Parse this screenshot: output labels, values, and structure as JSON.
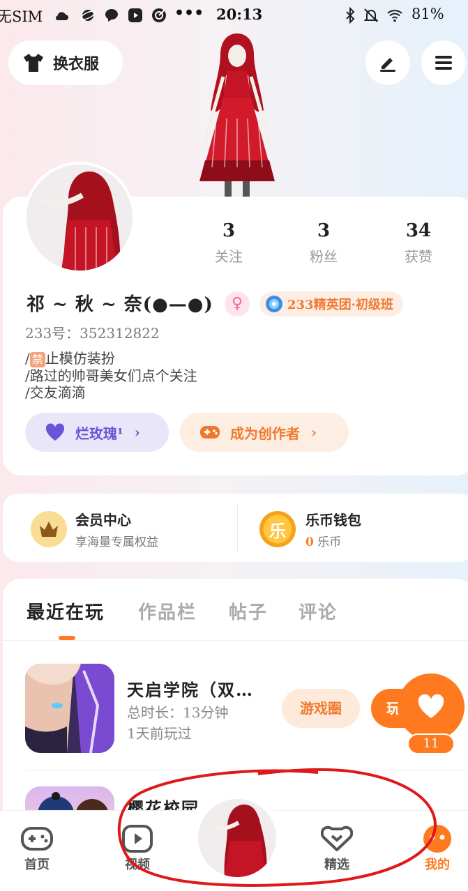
{
  "status_bar": {
    "sim": "无SIM",
    "time": "20:13",
    "battery": "81%"
  },
  "header": {
    "wardrobe_label": "换衣服"
  },
  "profile": {
    "username": "祁 ~ 秋 ~ 奈(●—●)",
    "uid_label": "233号：352312822",
    "gender_symbol": "♀",
    "group_badge": "233精英团·初级班",
    "bio_line1_badge": "禁",
    "bio_line1": "止模仿装扮",
    "bio_line2": "/路过的帅哥美女们点个关注",
    "bio_line3": "/交友滴滴",
    "bio_slash": "/",
    "stats": [
      {
        "num": "3",
        "label": "关注"
      },
      {
        "num": "3",
        "label": "粉丝"
      },
      {
        "num": "34",
        "label": "获赞"
      }
    ],
    "rose_pill": "烂玫瑰¹",
    "creator_pill": "成为创作者"
  },
  "member": {
    "vip_title": "会员中心",
    "vip_sub": "享海量专属权益",
    "wallet_title": "乐币钱包",
    "wallet_coin_char": "乐",
    "wallet_amount": "0",
    "wallet_unit": "乐币"
  },
  "tabs": [
    {
      "label": "最近在玩"
    },
    {
      "label": "作品栏"
    },
    {
      "label": "帖子"
    },
    {
      "label": "评论"
    }
  ],
  "recent_games": [
    {
      "title": "天启学院（双…",
      "duration": "总时长：13分钟",
      "last_played": "1天前玩过",
      "circle_btn": "游戏圈",
      "play_btn": "玩"
    },
    {
      "title": "樱花校园"
    }
  ],
  "floating_like": {
    "count": "11"
  },
  "bottom_nav": [
    {
      "label": "首页"
    },
    {
      "label": "视频"
    },
    {
      "label": "精选"
    },
    {
      "label": "我的"
    }
  ],
  "colors": {
    "accent": "#ff7a1e",
    "purple": "#6a55d8",
    "annotation_red": "#e01818"
  }
}
